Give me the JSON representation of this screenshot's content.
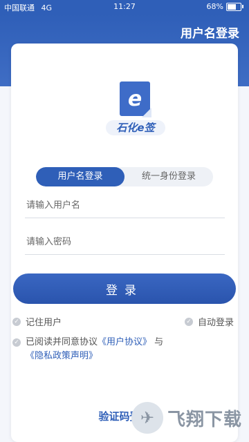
{
  "status_bar": {
    "carrier": "中国联通",
    "network": "4G",
    "time": "11:27",
    "battery": "68%"
  },
  "header": {
    "title": "用户名登录"
  },
  "logo": {
    "glyph": "e",
    "name": "石化e签"
  },
  "tabs": [
    {
      "label": "用户名登录",
      "active": true
    },
    {
      "label": "统一身份登录",
      "active": false
    }
  ],
  "form": {
    "username_placeholder": "请输入用户名",
    "password_placeholder": "请输入密码",
    "login_label": "登录"
  },
  "options": {
    "remember_user": "记住用户",
    "auto_login": "自动登录"
  },
  "agreement": {
    "prefix": "已阅读并同意协议",
    "user_agreement": "《用户协议》",
    "and": "与",
    "privacy_policy": "《隐私政策声明》"
  },
  "bottom": {
    "sms_login": "验证码登录"
  },
  "watermark": {
    "text": "飞翔下载"
  }
}
